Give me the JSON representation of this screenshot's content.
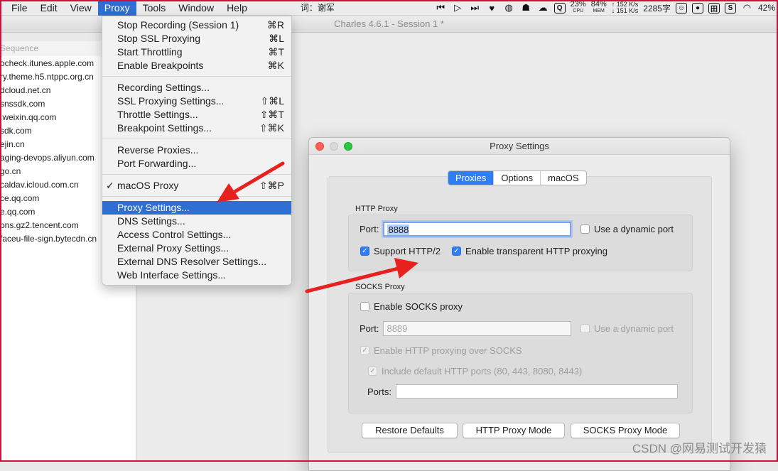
{
  "menubar": {
    "items": [
      "File",
      "Edit",
      "View",
      "Proxy",
      "Tools",
      "Window",
      "Help"
    ],
    "ime_text": "词：谢军",
    "cpu": {
      "value": "23%",
      "label": "CPU"
    },
    "mem": {
      "value": "84%",
      "label": "MEM"
    },
    "net_up": "↑ 152 K/s",
    "net_down": "↓ 151 K/s",
    "word_count": "2285字",
    "battery": "42"
  },
  "window": {
    "title": "Charles 4.6.1 - Session 1 *"
  },
  "sidebar": {
    "header": "Sequence",
    "rows": [
      "ocheck.itunes.apple.com",
      "ry.theme.h5.ntppc.org.cn",
      "dcloud.net.cn",
      "snssdk.com",
      ".weixin.qq.com",
      "sdk.com",
      "ejin.cn",
      "aging-devops.aliyun.com",
      "go.cn",
      "caldav.icloud.com.cn",
      "ce.qq.com",
      "e.qq.com",
      "pns.gz2.tencent.com",
      "faceu-file-sign.bytecdn.cn"
    ]
  },
  "proxy_menu": {
    "group1": [
      {
        "label": "Stop Recording (Session 1)",
        "shortcut": "⌘R"
      },
      {
        "label": "Stop SSL Proxying",
        "shortcut": "⌘L"
      },
      {
        "label": "Start Throttling",
        "shortcut": "⌘T"
      },
      {
        "label": "Enable Breakpoints",
        "shortcut": "⌘K"
      }
    ],
    "group2": [
      {
        "label": "Recording Settings...",
        "shortcut": ""
      },
      {
        "label": "SSL Proxying Settings...",
        "shortcut": "⇧⌘L"
      },
      {
        "label": "Throttle Settings...",
        "shortcut": "⇧⌘T"
      },
      {
        "label": "Breakpoint Settings...",
        "shortcut": "⇧⌘K"
      }
    ],
    "group3": [
      {
        "label": "Reverse Proxies...",
        "shortcut": ""
      },
      {
        "label": "Port Forwarding...",
        "shortcut": ""
      }
    ],
    "group4": [
      {
        "label": "macOS Proxy",
        "shortcut": "⇧⌘P",
        "check": "✓"
      }
    ],
    "group5": [
      {
        "label": "Proxy Settings...",
        "shortcut": ""
      },
      {
        "label": "DNS Settings...",
        "shortcut": ""
      },
      {
        "label": "Access Control Settings...",
        "shortcut": ""
      },
      {
        "label": "External Proxy Settings...",
        "shortcut": ""
      },
      {
        "label": "External DNS Resolver Settings...",
        "shortcut": ""
      },
      {
        "label": "Web Interface Settings...",
        "shortcut": ""
      }
    ]
  },
  "dialog": {
    "title": "Proxy Settings",
    "tabs": [
      "Proxies",
      "Options",
      "macOS"
    ],
    "http": {
      "group_label": "HTTP Proxy",
      "port_label": "Port:",
      "port_value": "8888",
      "dynamic_port": "Use a dynamic port",
      "http2": "Support HTTP/2",
      "transparent": "Enable transparent HTTP proxying"
    },
    "socks": {
      "group_label": "SOCKS Proxy",
      "enable": "Enable SOCKS proxy",
      "port_label": "Port:",
      "port_placeholder": "8889",
      "dynamic_port": "Use a dynamic port",
      "over_socks": "Enable HTTP proxying over SOCKS",
      "default_ports": "Include default HTTP ports (80, 443, 8080, 8443)",
      "ports_label": "Ports:"
    },
    "buttons": {
      "restore": "Restore Defaults",
      "http_mode": "HTTP Proxy Mode",
      "socks_mode": "SOCKS Proxy Mode"
    }
  },
  "watermark": "CSDN @网易测试开发猿",
  "colors": {
    "accent": "#2f6fd3",
    "arrow": "#e8211f",
    "frame": "#c8143c"
  }
}
